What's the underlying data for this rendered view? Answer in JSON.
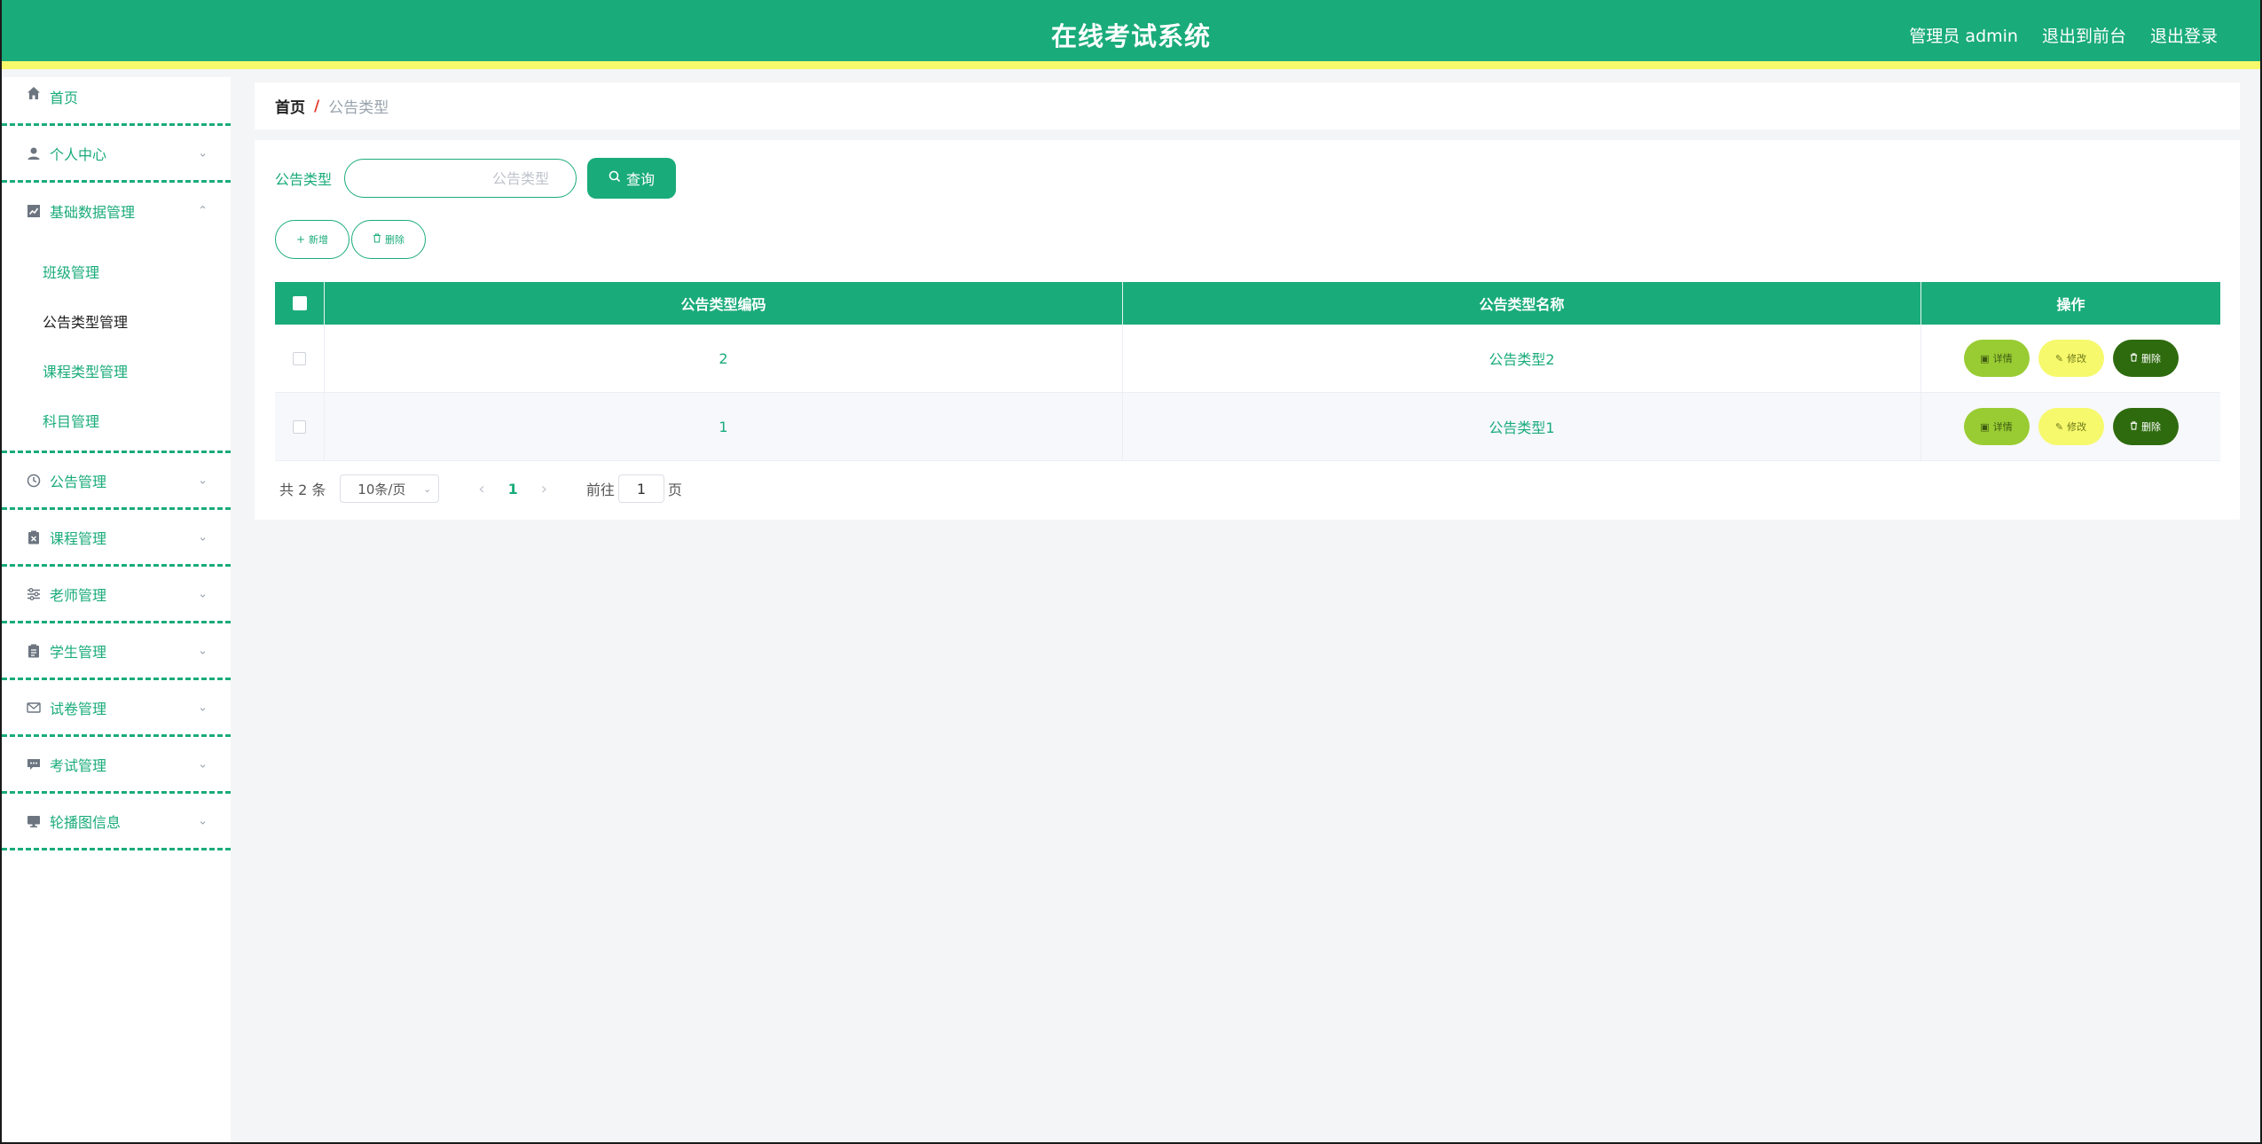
{
  "header": {
    "title": "在线考试系统",
    "user": "管理员 admin",
    "to_front": "退出到前台",
    "logout": "退出登录"
  },
  "sidebar": {
    "home": "首页",
    "items": [
      {
        "label": "个人中心",
        "icon": "user-icon"
      },
      {
        "label": "基础数据管理",
        "icon": "chart-icon",
        "expanded": true,
        "children": [
          "班级管理",
          "公告类型管理",
          "课程类型管理",
          "科目管理"
        ],
        "active_child": 1
      },
      {
        "label": "公告管理",
        "icon": "clock-icon"
      },
      {
        "label": "课程管理",
        "icon": "clipboard-x-icon"
      },
      {
        "label": "老师管理",
        "icon": "sliders-icon"
      },
      {
        "label": "学生管理",
        "icon": "clipboard-icon"
      },
      {
        "label": "试卷管理",
        "icon": "mail-icon"
      },
      {
        "label": "考试管理",
        "icon": "chat-icon"
      },
      {
        "label": "轮播图信息",
        "icon": "monitor-icon"
      }
    ]
  },
  "breadcrumb": {
    "home": "首页",
    "separator": "/",
    "current": "公告类型"
  },
  "search": {
    "label": "公告类型",
    "placeholder": "公告类型",
    "button": "查询"
  },
  "actions": {
    "add": "新增",
    "delete": "删除"
  },
  "table": {
    "columns": [
      "公告类型编码",
      "公告类型名称",
      "操作"
    ],
    "rows": [
      {
        "code": "2",
        "name": "公告类型2"
      },
      {
        "code": "1",
        "name": "公告类型1"
      }
    ],
    "ops": {
      "detail": "详情",
      "edit": "修改",
      "delete": "删除"
    }
  },
  "pagination": {
    "total": "共 2 条",
    "page_size": "10条/页",
    "current_page": "1",
    "goto_label": "前往",
    "goto_value": "1",
    "page_suffix": "页"
  },
  "colors": {
    "primary": "#1aab7b",
    "accent_stripe": "#f6f96b",
    "detail_btn": "#99cc33",
    "edit_btn": "#f6f96b",
    "delete_btn": "#2e6b0e"
  }
}
